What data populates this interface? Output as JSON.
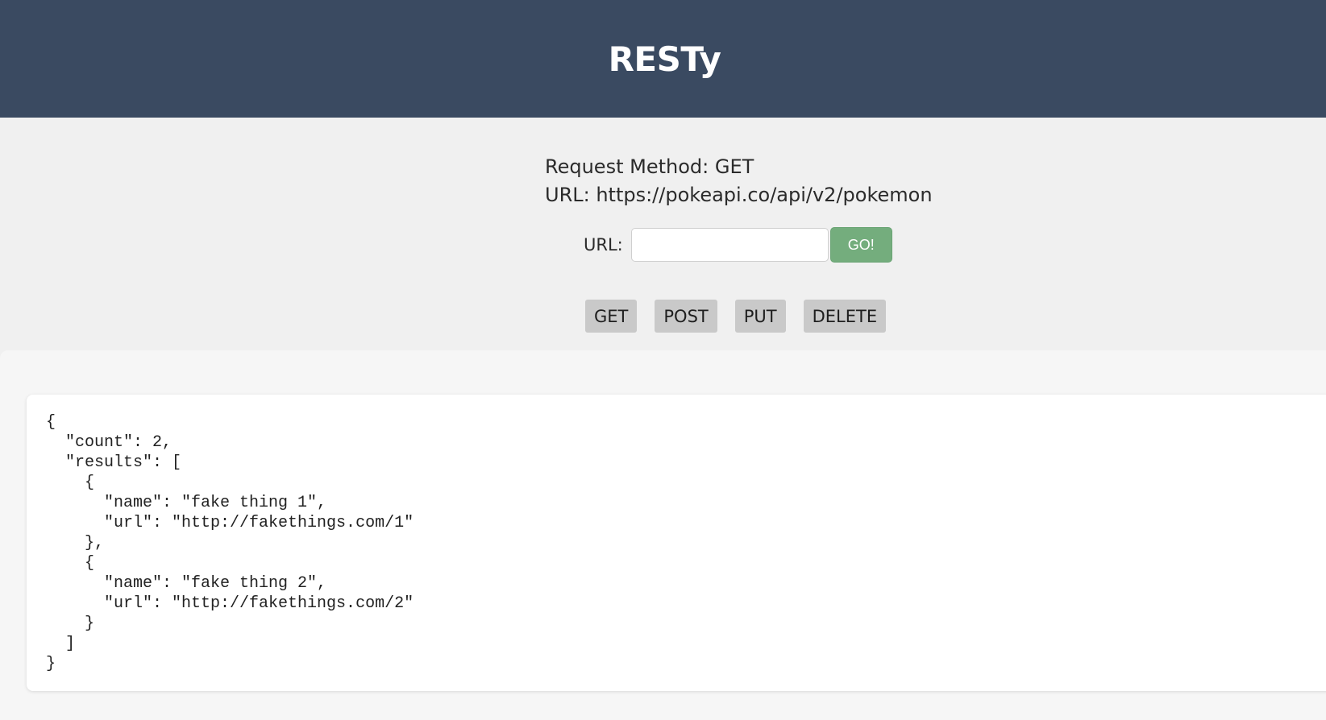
{
  "header": {
    "title": "RESTy"
  },
  "request_info": {
    "method_line": "Request Method: GET",
    "url_line": "URL: https://pokeapi.co/api/v2/pokemon"
  },
  "form": {
    "url_label": "URL:",
    "url_value": "",
    "go_label": "GO!"
  },
  "methods": [
    {
      "label": "GET"
    },
    {
      "label": "POST"
    },
    {
      "label": "PUT"
    },
    {
      "label": "DELETE"
    }
  ],
  "response": {
    "lines": [
      "{",
      "  \"count\": 2,",
      "  \"results\": [",
      "    {",
      "      \"name\": \"fake thing 1\",",
      "      \"url\": \"http://fakethings.com/1\"",
      "    },",
      "    {",
      "      \"name\": \"fake thing 2\",",
      "      \"url\": \"http://fakethings.com/2\"",
      "    }",
      "  ]",
      "}"
    ]
  },
  "colors": {
    "header_bg": "#3a4a61",
    "go_button": "#74ad7d",
    "method_button": "#c9c9c9"
  }
}
